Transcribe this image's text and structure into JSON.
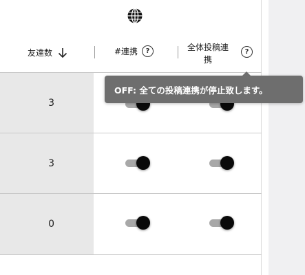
{
  "header": {
    "friends_label": "友達数",
    "sort_arrow": "↓",
    "hashtag_label": "#連携",
    "all_posts_line1": "全体投稿連",
    "all_posts_line2": "携",
    "help_glyph": "?"
  },
  "rows": [
    {
      "friends": "3",
      "hashtag_on": true,
      "all_on": true
    },
    {
      "friends": "3",
      "hashtag_on": true,
      "all_on": true
    },
    {
      "friends": "0",
      "hashtag_on": true,
      "all_on": true
    }
  ],
  "tooltip": {
    "text": "OFF: 全ての投稿連携が停止致します。"
  },
  "icons": {
    "globe": "globe-icon",
    "help": "help-circle-icon",
    "sort": "arrow-down-icon"
  },
  "colors": {
    "toggle_knob": "#0a0a0a",
    "toggle_track": "#a8a8a8",
    "tooltip_bg": "#6e6e6e",
    "highlight_cell": "#e8e8e8"
  }
}
